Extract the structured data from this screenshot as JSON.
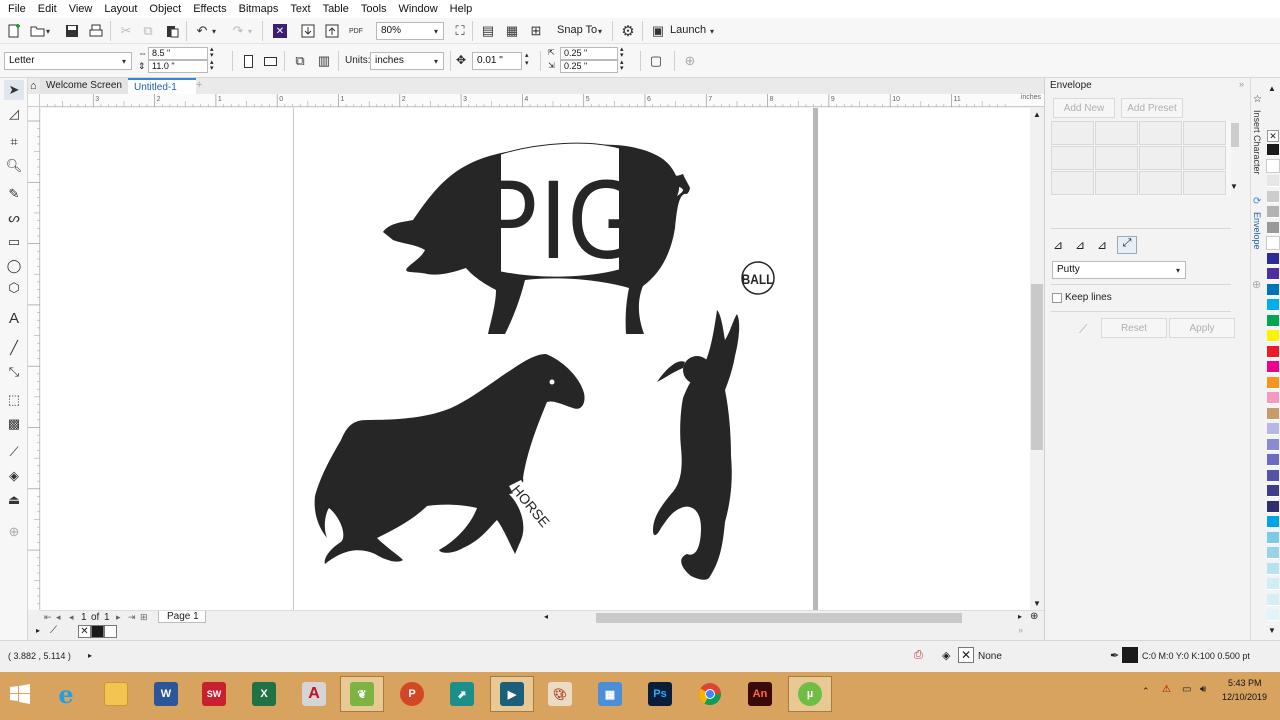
{
  "menu": [
    "File",
    "Edit",
    "View",
    "Layout",
    "Object",
    "Effects",
    "Bitmaps",
    "Text",
    "Table",
    "Tools",
    "Window",
    "Help"
  ],
  "toolbar": {
    "zoom": "80%",
    "snap_to": "Snap To",
    "launch": "Launch"
  },
  "propbar": {
    "page_size": "Letter",
    "width": "8.5 \"",
    "height": "11.0 \"",
    "units_label": "Units:",
    "units": "inches",
    "nudge": "0.01 \"",
    "dup_x": "0.25 \"",
    "dup_y": "0.25 \""
  },
  "tabs": [
    "Welcome Screen",
    "Untitled-1"
  ],
  "ruler": {
    "unit": "inches",
    "ticks": [
      "4",
      "3",
      "2",
      "1",
      "0",
      "1",
      "2",
      "3",
      "4",
      "5",
      "6",
      "7",
      "8",
      "9",
      "10",
      "11"
    ]
  },
  "artwork": {
    "pig_text": "PIG",
    "ball_text": "BALL",
    "horse_text": "HORSE"
  },
  "pager": {
    "current": "1",
    "of_label": "of",
    "total": "1",
    "page_tab": "Page 1"
  },
  "docker": {
    "title": "Envelope",
    "add_new": "Add New",
    "add_preset": "Add Preset",
    "mode": "Putty",
    "keep_lines": "Keep lines",
    "reset": "Reset",
    "apply": "Apply",
    "side_tab_1": "Insert Character",
    "side_tab_2": "Envelope"
  },
  "status": {
    "coords": "( 3.882 , 5.114 )",
    "fill": "None",
    "outline": "C:0 M:0 Y:0 K:100  0.500 pt"
  },
  "taskbar": {
    "time": "5:43 PM",
    "date": "12/10/2019",
    "apps": [
      "start",
      "ie",
      "explorer",
      "word",
      "solidworks",
      "excel",
      "acrobat",
      "corel-vector",
      "powerpoint",
      "app-teal-1",
      "app-teal-2",
      "paint",
      "control-panel",
      "photoshop",
      "chrome",
      "animate",
      "utorrent"
    ]
  },
  "colors": {
    "swatches": [
      "#1a1a1a",
      "#ffffff",
      "#e6e6e6",
      "#cccccc",
      "#b3b3b3",
      "#999999",
      "#ffffff",
      "#2b2b9a",
      "#4d2fa0",
      "#0072bc",
      "#00aeef",
      "#00a651",
      "#fff200",
      "#ed1c24",
      "#ec008c",
      "#f7941d",
      "#f49ac1",
      "#c69c6d",
      "#b7b7e5",
      "#8a8ad6",
      "#6b6bc5",
      "#5353a7",
      "#3d3d8a",
      "#2f2f6e",
      "#00a2e8",
      "#7ecbe8",
      "#9ad3e6",
      "#b9e2ee",
      "#d1eef5",
      "#d7eef4",
      "#e1f4f8"
    ]
  }
}
